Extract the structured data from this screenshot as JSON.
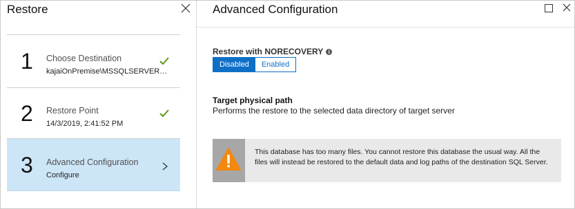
{
  "left_blade": {
    "title": "Restore",
    "steps": [
      {
        "number": "1",
        "title": "Choose Destination",
        "subtitle": "kajaiOnPremise\\MSSQLSERVER\\t...",
        "status": "complete"
      },
      {
        "number": "2",
        "title": "Restore Point",
        "subtitle": "14/3/2019, 2:41:52 PM",
        "status": "complete"
      },
      {
        "number": "3",
        "title": "Advanced Configuration",
        "subtitle": "Configure",
        "status": "active"
      }
    ]
  },
  "right_blade": {
    "title": "Advanced Configuration",
    "norecovery": {
      "label": "Restore with NORECOVERY",
      "options": [
        "Disabled",
        "Enabled"
      ],
      "selected": "Disabled"
    },
    "target_path": {
      "title": "Target physical path",
      "description": "Performs the restore to the selected data directory of target server"
    },
    "warning": {
      "text": "This database has too many files. You cannot restore this database the usual way. All the files will instead be restored to the default data and log paths of the destination SQL Server."
    }
  },
  "colors": {
    "accent": "#0f6fc6",
    "active_step_bg": "#cde6f7",
    "check_green": "#5c9a1b",
    "warning_orange": "#f2880f"
  },
  "icons": [
    "close-icon",
    "checkmark-icon",
    "chevron-right-icon",
    "maximize-icon",
    "info-icon",
    "warning-icon"
  ]
}
